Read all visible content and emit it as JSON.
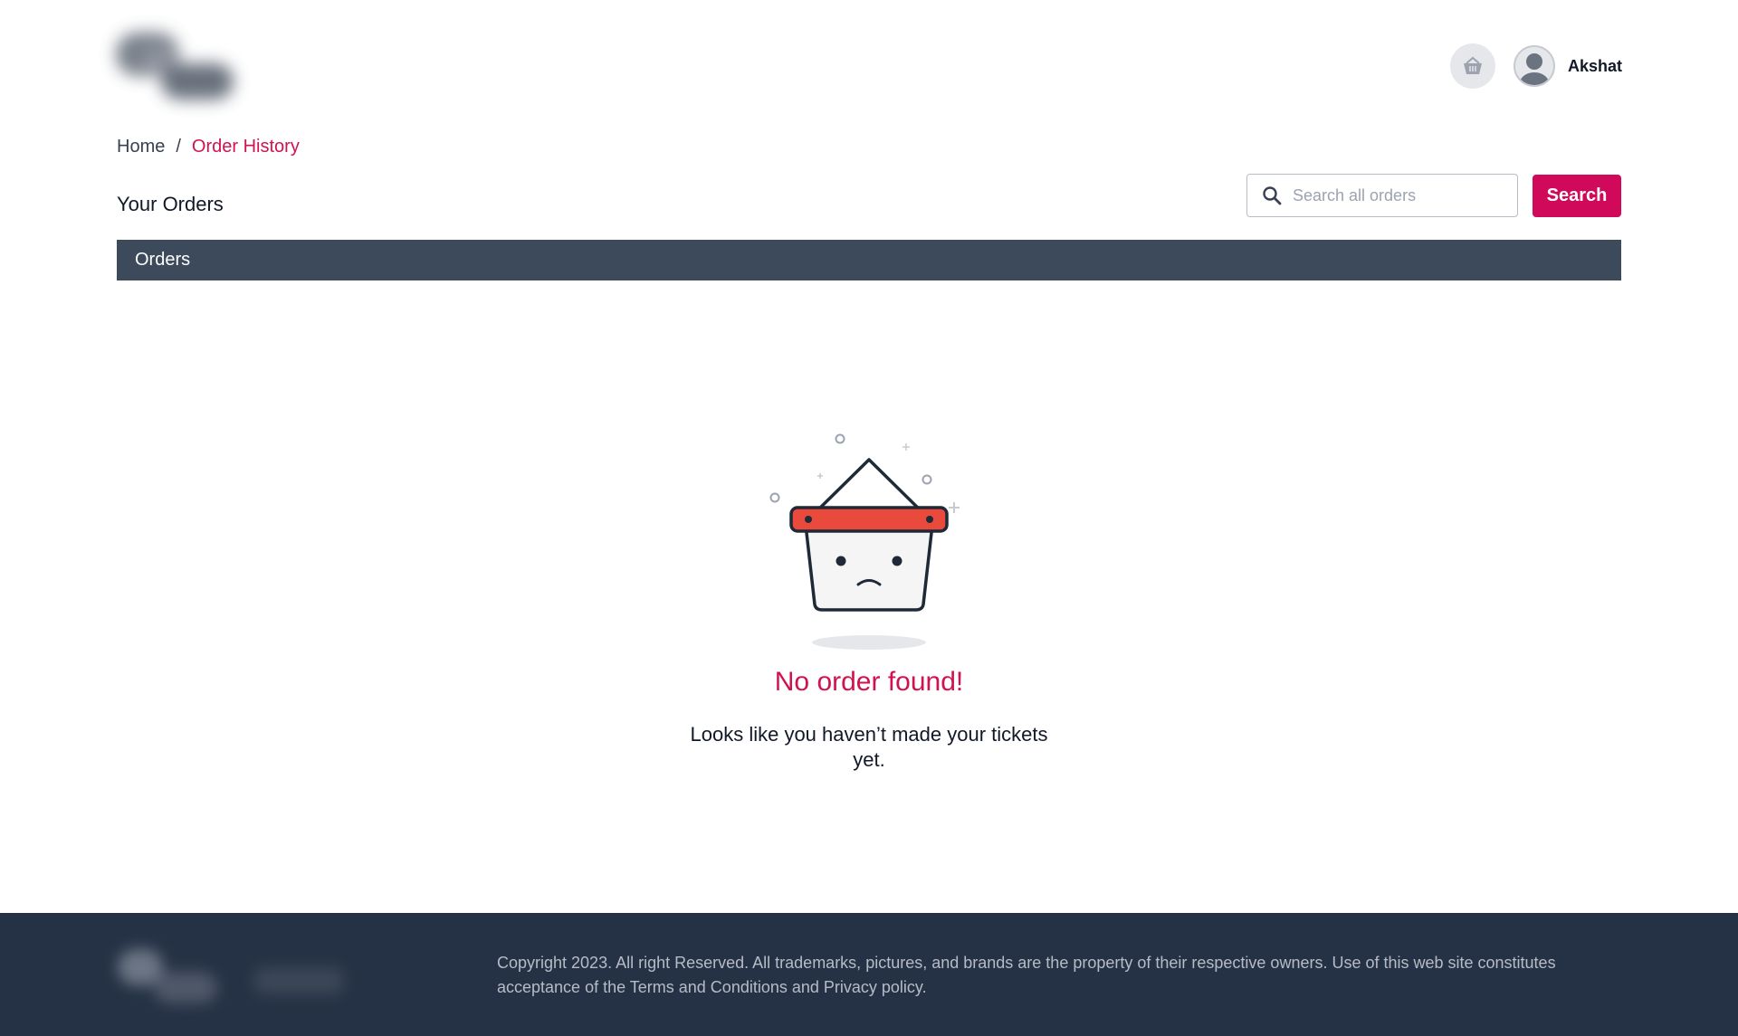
{
  "header": {
    "cart_icon": "basket-icon",
    "avatar_icon": "user-avatar-icon",
    "user_name": "Akshat"
  },
  "breadcrumb": {
    "home": "Home",
    "separator": "/",
    "current": "Order History"
  },
  "page_title": "Your Orders",
  "search": {
    "placeholder": "Search all orders",
    "value": "",
    "button_label": "Search"
  },
  "orders_bar": {
    "label": "Orders"
  },
  "empty_state": {
    "title": "No order found!",
    "message": "Looks like you haven’t made your tickets yet.",
    "illustration": "sad-basket-icon"
  },
  "footer": {
    "copyright": "Copyright 2023. All right Reserved. All trademarks, pictures, and brands are the property of their respective owners. Use of this web site constitutes acceptance of the Terms and Conditions and Privacy policy."
  },
  "colors": {
    "accent": "#d1095a",
    "orders_bar": "#3d4a5c",
    "footer": "#253245"
  }
}
